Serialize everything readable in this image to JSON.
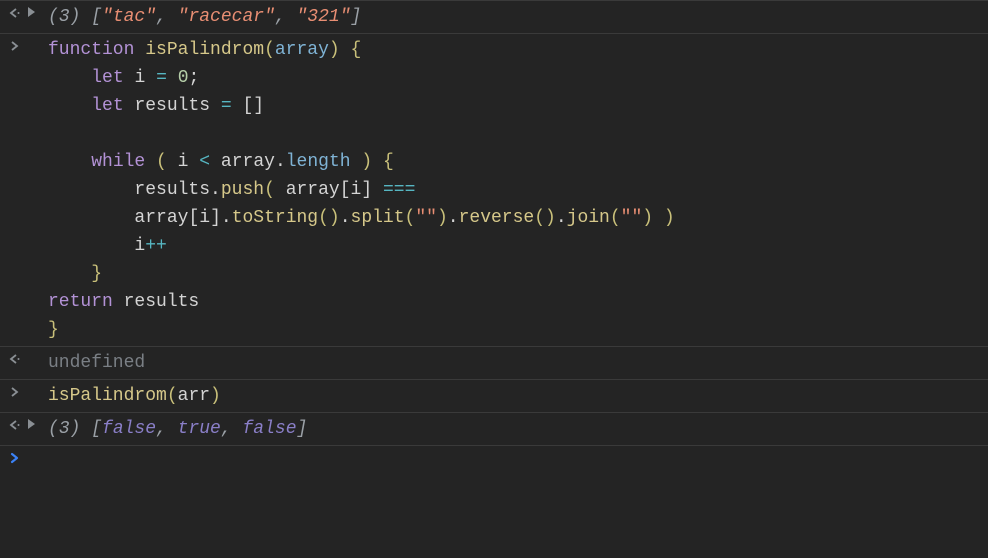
{
  "rows": {
    "result1": {
      "len": "(3)",
      "open": "[",
      "s1": "\"tac\"",
      "c1": ", ",
      "s2": "\"racecar\"",
      "c2": ", ",
      "s3": "\"321\"",
      "close": "]"
    },
    "code": {
      "l1_kw": "function",
      "l1_sp1": " ",
      "l1_name": "isPalindrom",
      "l1_po": "(",
      "l1_param": "array",
      "l1_pc": ")",
      "l1_sp2": " ",
      "l1_bo": "{",
      "l2_indent": "    ",
      "l2_kw": "let",
      "l2_sp": " ",
      "l2_id": "i",
      "l2_sp2": " ",
      "l2_eq": "=",
      "l2_sp3": " ",
      "l2_num": "0",
      "l2_semi": ";",
      "l3_indent": "    ",
      "l3_kw": "let",
      "l3_sp": " ",
      "l3_id": "results",
      "l3_sp2": " ",
      "l3_eq": "=",
      "l3_sp3": " ",
      "l3_arr": "[]",
      "l5_indent": "    ",
      "l5_kw": "while",
      "l5_sp": " ",
      "l5_po": "(",
      "l5_sp2": " ",
      "l5_id": "i",
      "l5_sp3": " ",
      "l5_lt": "<",
      "l5_sp4": " ",
      "l5_arr": "array",
      "l5_dot": ".",
      "l5_len": "length",
      "l5_sp5": " ",
      "l5_pc": ")",
      "l5_sp6": " ",
      "l5_bo": "{",
      "l6_indent": "        ",
      "l6_id": "results",
      "l6_dot": ".",
      "l6_push": "push",
      "l6_po": "(",
      "l6_sp": " ",
      "l6_arr": "array",
      "l6_bo": "[",
      "l6_i": "i",
      "l6_bc": "]",
      "l6_sp2": " ",
      "l6_eq": "===",
      "l7_indent": "        ",
      "l7_arr": "array",
      "l7_bo": "[",
      "l7_i": "i",
      "l7_bc": "]",
      "l7_dot1": ".",
      "l7_tostr": "toString",
      "l7_p1": "()",
      "l7_dot2": ".",
      "l7_split": "split",
      "l7_po2": "(",
      "l7_q1": "\"\"",
      "l7_pc2": ")",
      "l7_dot3": ".",
      "l7_rev": "reverse",
      "l7_p3": "()",
      "l7_dot4": ".",
      "l7_join": "join",
      "l7_po4": "(",
      "l7_q2": "\"\"",
      "l7_pc4": ")",
      "l7_sp": " ",
      "l7_pc5": ")",
      "l8_indent": "        ",
      "l8_id": "i",
      "l8_pp": "++",
      "l9_indent": "    ",
      "l9_bc": "}",
      "l10_kw": "return",
      "l10_sp": " ",
      "l10_id": "results",
      "l11_bc": "}"
    },
    "undef": "undefined",
    "call": {
      "name": "isPalindrom",
      "po": "(",
      "arg": "arr",
      "pc": ")"
    },
    "result2": {
      "len": "(3)",
      "open": "[",
      "b1": "false",
      "c1": ", ",
      "b2": "true",
      "c2": ", ",
      "b3": "false",
      "close": "]"
    },
    "prompt": "❯"
  }
}
